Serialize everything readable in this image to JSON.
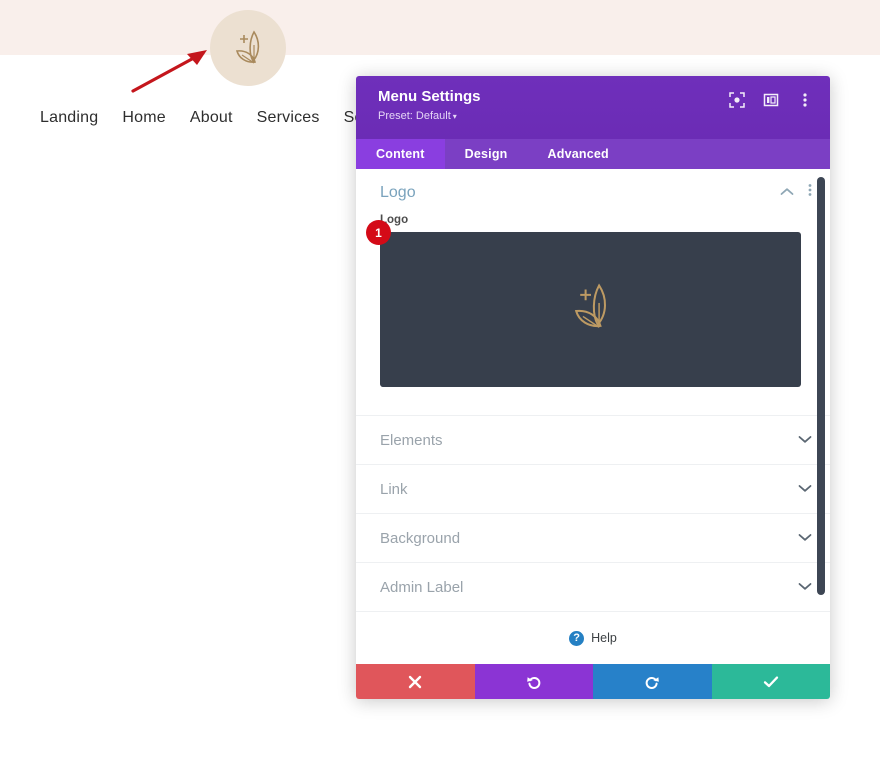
{
  "site_preview": {
    "banner_color": "#f9efeb",
    "logo_circle_color": "#ece0d1",
    "logo_icon": "leaf-sparkle-logo-icon",
    "nav_items": [
      "Landing",
      "Home",
      "About",
      "Services",
      "Service"
    ],
    "annotation": {
      "name": "red-arrow-annotation",
      "color": "#c4161c"
    }
  },
  "modal": {
    "title": "Menu Settings",
    "preset": "Preset: Default",
    "preset_caret": "▾",
    "header_color": "#6c2eb7",
    "header_icons": [
      {
        "name": "focus-target-icon"
      },
      {
        "name": "layout-panel-icon"
      },
      {
        "name": "more-vertical-icon"
      }
    ],
    "tabs": [
      {
        "label": "Content",
        "active": true
      },
      {
        "label": "Design",
        "active": false
      },
      {
        "label": "Advanced",
        "active": false
      }
    ],
    "open_section": {
      "title": "Logo",
      "title_color": "#7aa3bd",
      "collapse_icon": "chevron-up-icon",
      "more_icon": "more-vertical-icon",
      "field_label": "Logo",
      "badge": "1",
      "badge_color": "#d40a17",
      "preview_bg": "#373f4c",
      "preview_image": "leaf-sparkle-logo-icon"
    },
    "closed_sections": [
      {
        "label": "Elements"
      },
      {
        "label": "Link"
      },
      {
        "label": "Background"
      },
      {
        "label": "Admin Label"
      }
    ],
    "help": {
      "label": "Help",
      "icon_glyph": "?",
      "icon_color": "#2580c3"
    },
    "footer_buttons": [
      {
        "name": "cancel-button",
        "icon": "close-icon",
        "color": "#e0565b"
      },
      {
        "name": "undo-button",
        "icon": "undo-icon",
        "color": "#8b34d4"
      },
      {
        "name": "redo-button",
        "icon": "redo-icon",
        "color": "#2781c9"
      },
      {
        "name": "save-button",
        "icon": "check-icon",
        "color": "#2cb999"
      }
    ]
  }
}
